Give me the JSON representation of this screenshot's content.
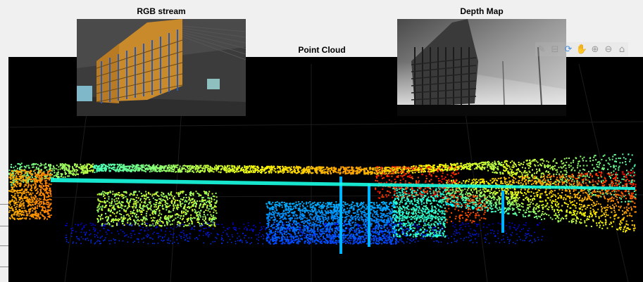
{
  "rgb_panel": {
    "title": "RGB stream"
  },
  "depth_panel": {
    "title": "Depth Map"
  },
  "point_cloud_panel": {
    "title": "Point Cloud"
  },
  "toolbar": {
    "items": [
      {
        "name": "brush-icon",
        "glyph": "✎"
      },
      {
        "name": "data-tips-icon",
        "glyph": "⊟"
      },
      {
        "name": "rotate-3d-icon",
        "glyph": "⟳",
        "active": true
      },
      {
        "name": "pan-icon",
        "glyph": "✋"
      },
      {
        "name": "zoom-in-icon",
        "glyph": "⊕"
      },
      {
        "name": "zoom-out-icon",
        "glyph": "⊖"
      },
      {
        "name": "home-icon",
        "glyph": "⌂"
      }
    ]
  }
}
